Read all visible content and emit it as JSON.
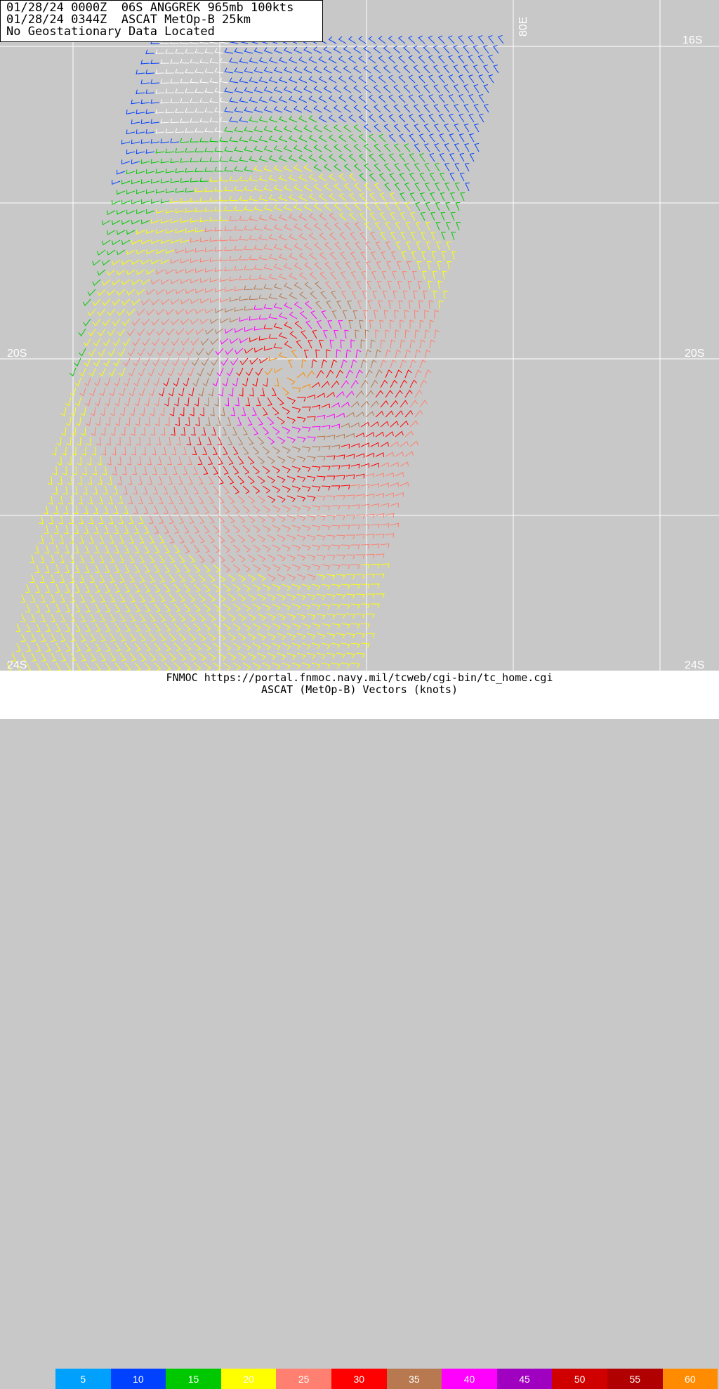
{
  "header": {
    "line1": "01/28/24 0000Z  06S ANGGREK 965mb 100kts",
    "line2": "01/28/24 0344Z  ASCAT MetOp-B 25km",
    "line3": "No Geostationary Data Located"
  },
  "map": {
    "lat_labels": [
      {
        "text": "16S",
        "side": "right"
      },
      {
        "text": "20S",
        "side": "left"
      },
      {
        "text": "20S",
        "side": "right"
      },
      {
        "text": "24S",
        "side": "left"
      },
      {
        "text": "24S",
        "side": "right"
      }
    ],
    "lon_label": "80E",
    "background_color": "#c8c8c8",
    "grid_color": "#ffffff"
  },
  "footer": {
    "source": "FNMOC https://portal.fnmoc.navy.mil/tcweb/cgi-bin/tc_home.cgi",
    "legend_title": "ASCAT (MetOp-B) Vectors (knots)"
  },
  "legend": [
    {
      "value": "5",
      "color": "#00a0ff"
    },
    {
      "value": "10",
      "color": "#0040ff"
    },
    {
      "value": "15",
      "color": "#00c800"
    },
    {
      "value": "20",
      "color": "#ffff00"
    },
    {
      "value": "25",
      "color": "#ff8070"
    },
    {
      "value": "30",
      "color": "#ff0000"
    },
    {
      "value": "35",
      "color": "#b87850"
    },
    {
      "value": "40",
      "color": "#ff00ff"
    },
    {
      "value": "45",
      "color": "#a000c0"
    },
    {
      "value": "50",
      "color": "#d00000"
    },
    {
      "value": "55",
      "color": "#b00000"
    },
    {
      "value": "60",
      "color": "#ff8c00"
    }
  ]
}
